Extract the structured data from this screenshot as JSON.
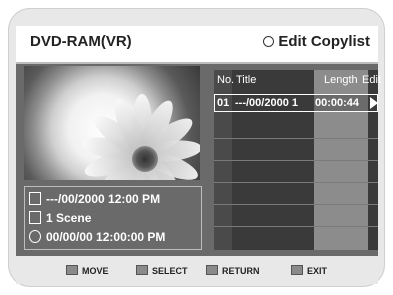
{
  "header": {
    "title": "DVD-RAM(VR)",
    "right_title": "Edit Copylist"
  },
  "table": {
    "headers": {
      "no": "No.",
      "title": "Title",
      "length": "Length",
      "edit": "Edit"
    },
    "selected_row": {
      "no": "01",
      "title": "---/00/2000 1",
      "length": "00:00:44"
    }
  },
  "info": {
    "date": "---/00/2000 12:00 PM",
    "scene": "1 Scene",
    "time": "00/00/00 12:00:00 PM"
  },
  "footer": {
    "move": "MOVE",
    "select": "SELECT",
    "return": "RETURN",
    "exit": "EXIT"
  }
}
